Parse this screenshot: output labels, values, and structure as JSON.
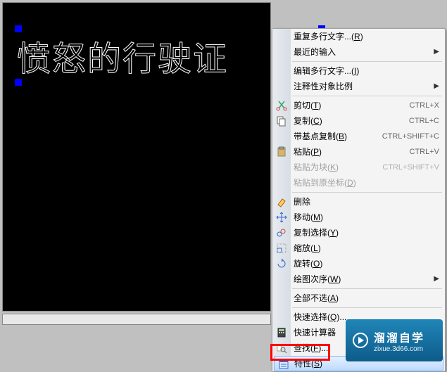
{
  "canvas": {
    "mtext": "愤怒的行驶证"
  },
  "menu": {
    "repeat_mtext": {
      "label": "重复多行文字...",
      "mn": "R"
    },
    "recent_input": {
      "label": "最近的输入"
    },
    "edit_mtext": {
      "label": "编辑多行文字...",
      "mn": "I"
    },
    "annotative_scale": {
      "label": "注释性对象比例"
    },
    "cut": {
      "label": "剪切",
      "mn": "T",
      "shortcut": "CTRL+X"
    },
    "copy": {
      "label": "复制",
      "mn": "C",
      "shortcut": "CTRL+C"
    },
    "copy_base": {
      "label": "带基点复制",
      "mn": "B",
      "shortcut": "CTRL+SHIFT+C"
    },
    "paste": {
      "label": "粘贴",
      "mn": "P",
      "shortcut": "CTRL+V"
    },
    "paste_block": {
      "label": "粘贴为块",
      "mn": "K",
      "shortcut": "CTRL+SHIFT+V"
    },
    "paste_orig": {
      "label": "粘贴到原坐标",
      "mn": "D"
    },
    "erase": {
      "label": "删除"
    },
    "move": {
      "label": "移动",
      "mn": "M"
    },
    "copy_sel": {
      "label": "复制选择",
      "mn": "Y"
    },
    "scale": {
      "label": "缩放",
      "mn": "L"
    },
    "rotate": {
      "label": "旋转",
      "mn": "O"
    },
    "draw_order": {
      "label": "绘图次序",
      "mn": "W"
    },
    "deselect_all": {
      "label": "全部不选",
      "mn": "A"
    },
    "quick_select": {
      "label": "快速选择",
      "mn": "Q",
      "suffix": "..."
    },
    "quickcalc": {
      "label": "快速计算器"
    },
    "find": {
      "label": "查找",
      "mn": "F",
      "suffix": "..."
    },
    "properties": {
      "label": "特性",
      "mn": "S"
    }
  },
  "watermark": {
    "title": "溜溜自学",
    "url": "zixue.3d66.com"
  }
}
